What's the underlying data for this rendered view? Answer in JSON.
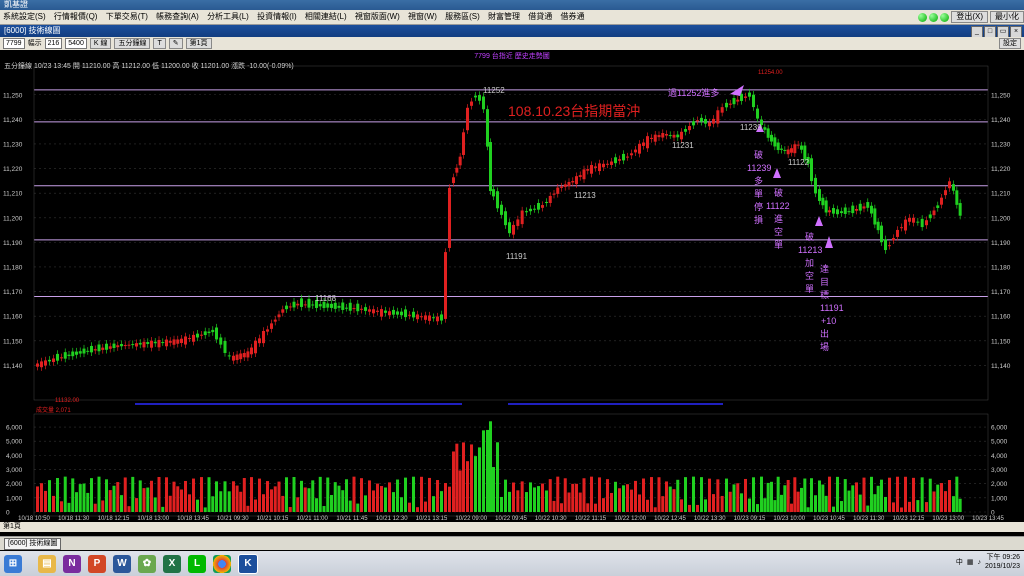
{
  "app": {
    "title": "凱基證"
  },
  "menu": [
    "系統設定(S)",
    "行情報價(Q)",
    "下單交易(T)",
    "帳務查詢(A)",
    "分析工具(L)",
    "投資情報(I)",
    "相關連結(L)",
    "視窗版面(W)",
    "視窗(W)",
    "服務區(S)",
    "財富管理",
    "借貸通",
    "借券通"
  ],
  "top_right": {
    "logout": "登出(X)",
    "min": "最小化"
  },
  "window": {
    "title": "[6000] 技術線圖"
  },
  "toolbar": {
    "symbol": "7799",
    "period_label": "幅示",
    "period_value": "216",
    "count_value": "5400",
    "kline": "K 線",
    "indicator": "五分鐘線",
    "tools": "T",
    "draw": "✎",
    "page": "第1頁",
    "settings": "設定"
  },
  "chart_header": "7799 台指近   歷史走勢圖",
  "infobar": "五分鐘線   10/23 13:45 開 11210.00 高 11212.00 低 11200.00 收 11201.00 漲跌 -10.00(-0.09%)",
  "annotation_title": "108.10.23台指期當沖",
  "annotations": {
    "a1": "過11252進多",
    "a2": [
      "破",
      "11239",
      "多",
      "單",
      "停",
      "損"
    ],
    "a3": [
      "破",
      "11122",
      "進",
      "空",
      "單"
    ],
    "a4": [
      "破",
      "11213",
      "加",
      "空",
      "單"
    ],
    "a5": [
      "達",
      "目",
      "標",
      "11191",
      "+10",
      "出",
      "場"
    ]
  },
  "price_labels": {
    "p11252": "11252",
    "p11239": "11239",
    "p11231": "11231",
    "p11213": "11213",
    "p11191": "11191",
    "p11168": "11168",
    "p11122": "11122",
    "high": "11254.00",
    "low": "11132.00"
  },
  "volume_label": "成交量 2,071",
  "chart_data": {
    "type": "candlestick",
    "y_ticks": [
      11140,
      11150,
      11160,
      11170,
      11180,
      11190,
      11200,
      11210,
      11220,
      11230,
      11240,
      11250
    ],
    "ylim": [
      11130,
      11256
    ],
    "h_lines": [
      11252,
      11239,
      11213,
      11191,
      11168
    ],
    "vol_ticks": [
      0,
      1000,
      2000,
      3000,
      4000,
      5000,
      6000
    ],
    "x_labels": [
      "10/18 10:50",
      "10/18 11:30",
      "10/18 12:15",
      "10/18 13:00",
      "10/18 13:45",
      "10/21 09:30",
      "10/21 10:15",
      "10/21 11:00",
      "10/21 11:45",
      "10/21 12:30",
      "10/21 13:15",
      "10/22 09:00",
      "10/22 09:45",
      "10/22 10:30",
      "10/22 11:15",
      "10/22 12:00",
      "10/22 12:45",
      "10/22 13:30",
      "10/23 09:15",
      "10/23 10:00",
      "10/23 10:45",
      "10/23 11:30",
      "10/23 12:15",
      "10/23 13:00",
      "10/23 13:45"
    ]
  },
  "status": {
    "page": "第1頁"
  },
  "doc_tab": "[6000] 技術線圖",
  "tray": {
    "ime": "中",
    "time": "下午 09:26",
    "date": "2019/10/23"
  },
  "taskbar_icons": [
    "folder",
    "onenote",
    "powerpoint",
    "word",
    "app1",
    "excel",
    "line",
    "chrome",
    "kgi"
  ]
}
